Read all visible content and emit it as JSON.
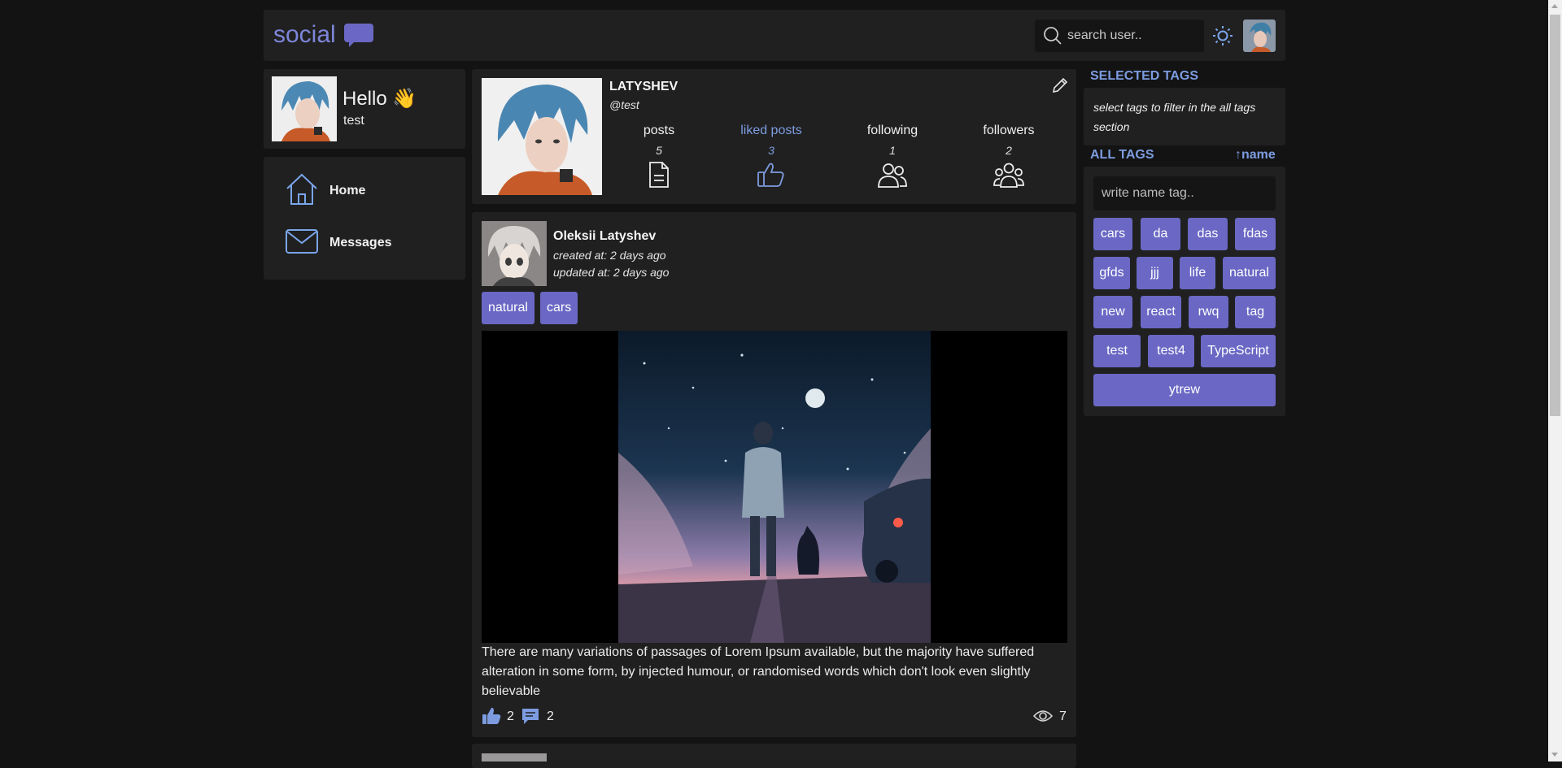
{
  "header": {
    "logo_text": "social",
    "search_placeholder": "search user..",
    "theme_icon": "sun-icon"
  },
  "greeting": {
    "title": "Hello 👋",
    "username": "test"
  },
  "nav": {
    "items": [
      {
        "label": "Home",
        "icon": "home-icon"
      },
      {
        "label": "Messages",
        "icon": "mail-icon"
      }
    ]
  },
  "profile": {
    "name": "LATYSHEV",
    "handle": "@test",
    "stats": [
      {
        "label": "posts",
        "value": "5",
        "icon": "document-icon",
        "active": false
      },
      {
        "label": "liked posts",
        "value": "3",
        "icon": "thumbs-up-icon",
        "active": true
      },
      {
        "label": "following",
        "value": "1",
        "icon": "users-icon",
        "active": false
      },
      {
        "label": "followers",
        "value": "2",
        "icon": "group-icon",
        "active": false
      }
    ]
  },
  "post": {
    "author": "Oleksii Latyshev",
    "created": "created at: 2 days ago",
    "updated": "updated at: 2 days ago",
    "tags": [
      "natural",
      "cars"
    ],
    "text": "There are many variations of passages of Lorem Ipsum available, but the majority have suffered alteration in some form, by injected humour, or randomised words which don't look even slightly believable",
    "likes": "2",
    "comments": "2",
    "views": "7"
  },
  "sidebar": {
    "selected_title": "SELECTED TAGS",
    "selected_hint": "select tags to filter in the all tags section",
    "all_title": "ALL TAGS",
    "sort_label": "↑name",
    "tag_input_placeholder": "write name tag..",
    "tags": [
      "cars",
      "da",
      "das",
      "fdas",
      "gfds",
      "jjj",
      "life",
      "natural",
      "new",
      "react",
      "rwq",
      "tag",
      "test",
      "test4",
      "TypeScript",
      "ytrew"
    ]
  },
  "colors": {
    "accent": "#6a68c4",
    "link": "#7d9ce0",
    "panel": "#202020",
    "background": "#131313"
  }
}
